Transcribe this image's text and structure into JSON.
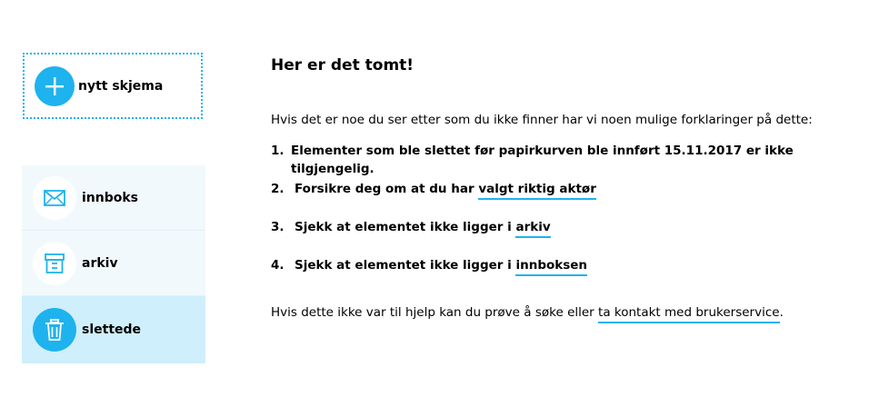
{
  "new_form": {
    "label": "nytt skjema",
    "icon": "plus-icon"
  },
  "nav": {
    "items": [
      {
        "label": "innboks",
        "icon": "envelope-icon",
        "active": false
      },
      {
        "label": "arkiv",
        "icon": "archive-icon",
        "active": false
      },
      {
        "label": "slettede",
        "icon": "trash-icon",
        "active": true
      }
    ]
  },
  "content": {
    "title": "Her er det tomt!",
    "intro": "Hvis det er noe du ser etter som du ikke finner har vi noen mulige forklaringer på dette:",
    "list": [
      {
        "num": "1.",
        "text": "Elementer som ble slettet før papirkurven ble innført 15.11.2017 er ikke tilgjengelig.",
        "link": ""
      },
      {
        "num": "2.",
        "text": "Forsikre deg om at du har ",
        "link": "valgt riktig aktør"
      },
      {
        "num": "3.",
        "text": "Sjekk at elementet ikke ligger i ",
        "link": "arkiv"
      },
      {
        "num": "4.",
        "text": "Sjekk at elementet ikke ligger i ",
        "link": "innboksen"
      }
    ],
    "outro_text": "Hvis dette ikke var til hjelp kan du prøve å søke eller ",
    "outro_link": "ta kontakt med brukerservice",
    "outro_end": "."
  },
  "colors": {
    "accent": "#1eb3ee",
    "nav_bg": "#f2f9fd",
    "nav_active_bg": "#cfeffc"
  }
}
